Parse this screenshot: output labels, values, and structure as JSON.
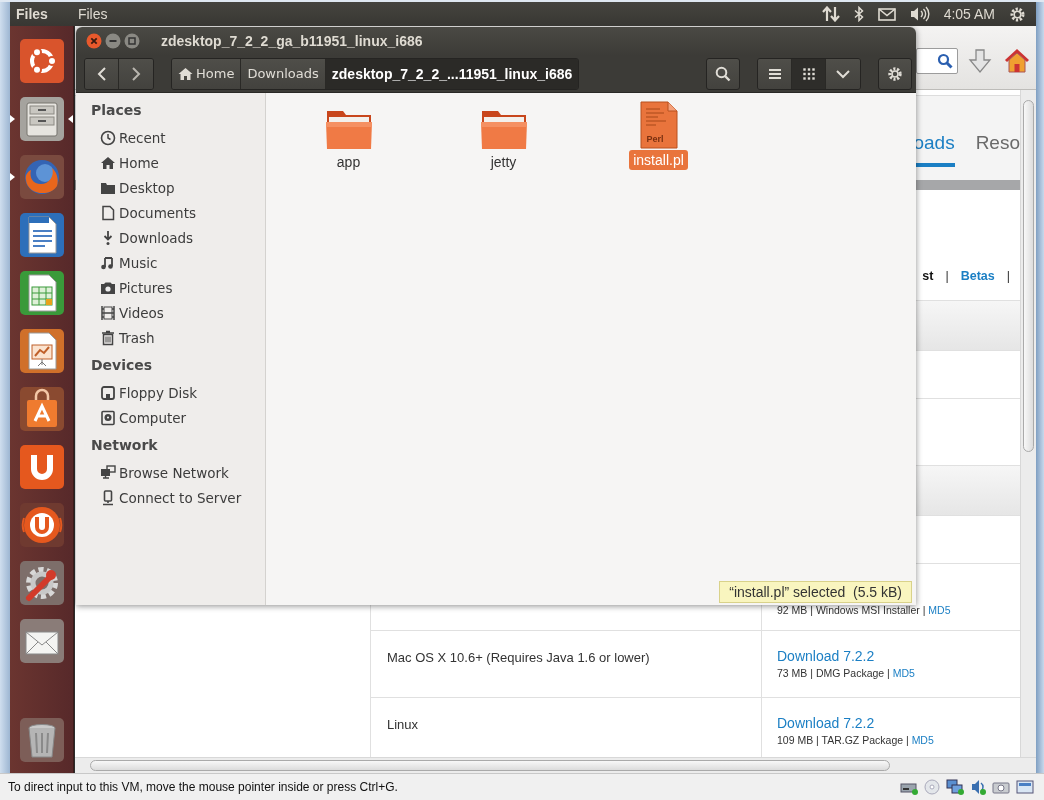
{
  "top_panel": {
    "app_title": "Files",
    "menus": [
      {
        "label": "Files"
      }
    ],
    "clock": "4:05 AM"
  },
  "launcher": {
    "items": [
      {
        "kind": "ubuntu",
        "running": false,
        "focused": false
      },
      {
        "kind": "files",
        "running": true,
        "focused": true
      },
      {
        "kind": "firefox",
        "running": true,
        "focused": false
      },
      {
        "kind": "writer",
        "running": false,
        "focused": false
      },
      {
        "kind": "calc",
        "running": false,
        "focused": false
      },
      {
        "kind": "impress",
        "running": false,
        "focused": false
      },
      {
        "kind": "software",
        "running": false,
        "focused": false
      },
      {
        "kind": "horseshoe",
        "running": false,
        "focused": false
      },
      {
        "kind": "horseshoe_music",
        "running": false,
        "focused": false
      },
      {
        "kind": "settings",
        "running": false,
        "focused": false
      },
      {
        "kind": "mail",
        "running": false,
        "focused": false
      },
      {
        "kind": "trash",
        "running": false,
        "focused": false
      }
    ]
  },
  "browser": {
    "nav_tabs": [
      {
        "label": "oads",
        "selected": true
      },
      {
        "label": "Reso",
        "selected": false
      }
    ],
    "filter_bar": [
      {
        "kind": "link",
        "label": "st",
        "selected": true
      },
      {
        "kind": "separator",
        "label": "|"
      },
      {
        "kind": "link",
        "label": "Betas",
        "selected": false
      },
      {
        "kind": "separator",
        "label": "|"
      }
    ],
    "rows": [
      {
        "details": "92 MB | Windows MSI Installer |",
        "details_link": "MD5"
      },
      {
        "platform": "Mac OS X 10.6+ (Requires Java 1.6 or lower)",
        "download": "Download 7.2.2",
        "details": "73 MB | DMG Package |",
        "details_link": "MD5"
      },
      {
        "platform": "Linux",
        "download": "Download 7.2.2",
        "details": "109 MB | TAR.GZ Package |",
        "details_link": "MD5"
      }
    ]
  },
  "files_window": {
    "title": "zdesktop_7_2_2_ga_b11951_linux_i686",
    "path": [
      {
        "label": "Home",
        "kind": "home",
        "selected": false
      },
      {
        "label": "Downloads",
        "kind": "folder",
        "selected": false
      },
      {
        "label": "zdesktop_7_2_2_...11951_linux_i686",
        "kind": "folder",
        "selected": true
      }
    ],
    "view_buttons": [
      {
        "kind": "list",
        "selected": false
      },
      {
        "kind": "grid",
        "selected": true
      },
      {
        "kind": "menu",
        "selected": false
      }
    ],
    "sidebar": [
      {
        "heading": "Places",
        "items": [
          {
            "label": "Recent",
            "kind": "recent"
          },
          {
            "label": "Home",
            "kind": "home"
          },
          {
            "label": "Desktop",
            "kind": "desktop"
          },
          {
            "label": "Documents",
            "kind": "documents"
          },
          {
            "label": "Downloads",
            "kind": "downloads"
          },
          {
            "label": "Music",
            "kind": "music"
          },
          {
            "label": "Pictures",
            "kind": "pictures"
          },
          {
            "label": "Videos",
            "kind": "videos"
          },
          {
            "label": "Trash",
            "kind": "trash"
          }
        ]
      },
      {
        "heading": "Devices",
        "items": [
          {
            "label": "Floppy Disk",
            "kind": "floppy"
          },
          {
            "label": "Computer",
            "kind": "computer"
          }
        ]
      },
      {
        "heading": "Network",
        "items": [
          {
            "label": "Browse Network",
            "kind": "network"
          },
          {
            "label": "Connect to Server",
            "kind": "server"
          }
        ]
      }
    ],
    "files": [
      {
        "name": "app",
        "kind": "folder",
        "selected": false
      },
      {
        "name": "jetty",
        "kind": "folder",
        "selected": false
      },
      {
        "name": "install.pl",
        "kind": "script",
        "icon_label": "Perl",
        "selected": true
      }
    ],
    "status": "“install.pl” selected  (5.5 kB)"
  },
  "vm_status": {
    "message": "To direct input to this VM, move the mouse pointer inside or press Ctrl+G."
  }
}
